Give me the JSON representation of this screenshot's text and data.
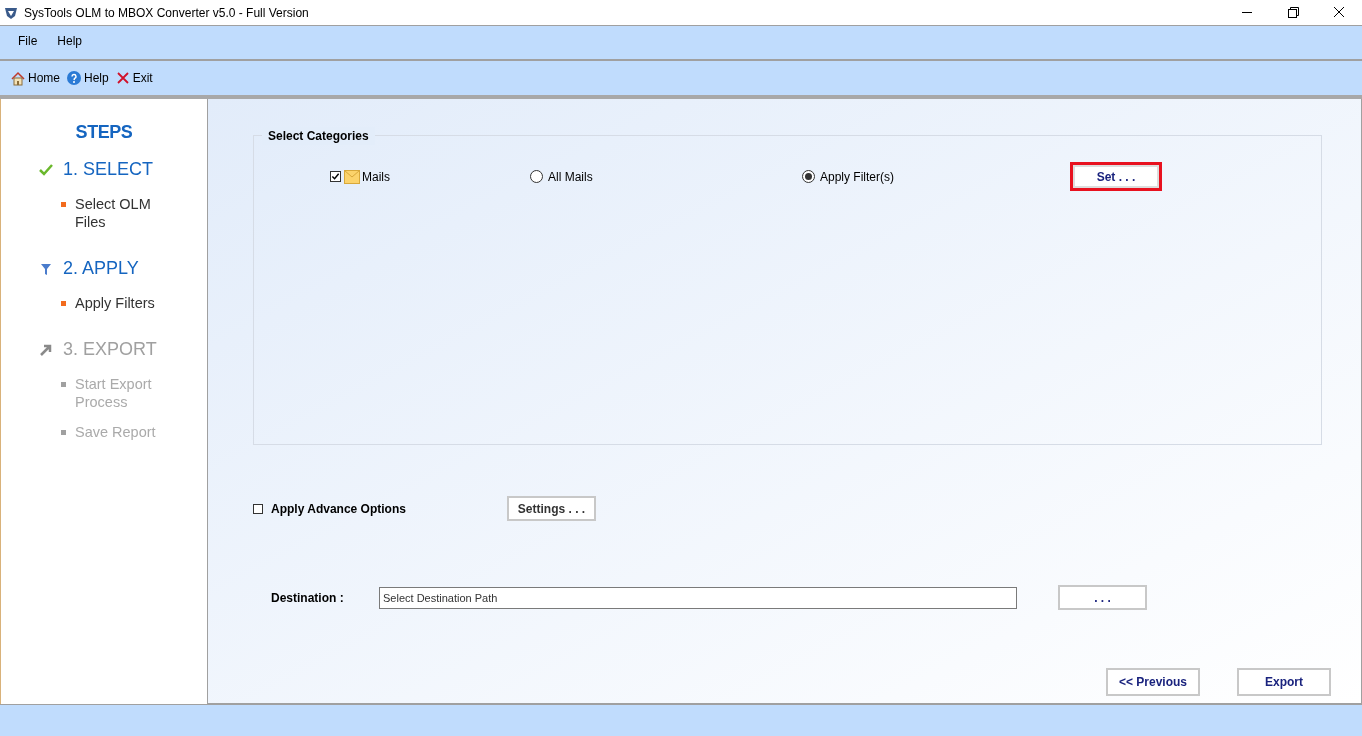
{
  "window": {
    "title": "SysTools OLM to MBOX Converter v5.0 - Full Version"
  },
  "menu": [
    "File",
    "Help"
  ],
  "toolbar": [
    {
      "kind": "home",
      "label": "Home"
    },
    {
      "kind": "help",
      "label": "Help"
    },
    {
      "kind": "exit",
      "label": "Exit"
    }
  ],
  "steps": {
    "title": "STEPS",
    "items": [
      {
        "kind": "select",
        "label": "1. SELECT",
        "enabled": true,
        "children": [
          "Select OLM Files"
        ]
      },
      {
        "kind": "apply",
        "label": "2. APPLY",
        "enabled": true,
        "children": [
          "Apply Filters"
        ]
      },
      {
        "kind": "export",
        "label": "3. EXPORT",
        "enabled": false,
        "children": [
          "Start Export Process",
          "Save Report"
        ]
      }
    ]
  },
  "categories": {
    "title": "Select Categories",
    "mails": {
      "label": "Mails",
      "checked": true
    },
    "options": [
      {
        "label": "All Mails",
        "selected": false
      },
      {
        "label": "Apply Filter(s)",
        "selected": true
      }
    ],
    "set_button": "Set . . ."
  },
  "advance": {
    "label": "Apply Advance Options",
    "checked": false,
    "button": "Settings . . ."
  },
  "destination": {
    "label": "Destination :",
    "placeholder": "Select Destination Path",
    "browse": ". . ."
  },
  "previous_button": "<< Previous",
  "export_button": "Export"
}
